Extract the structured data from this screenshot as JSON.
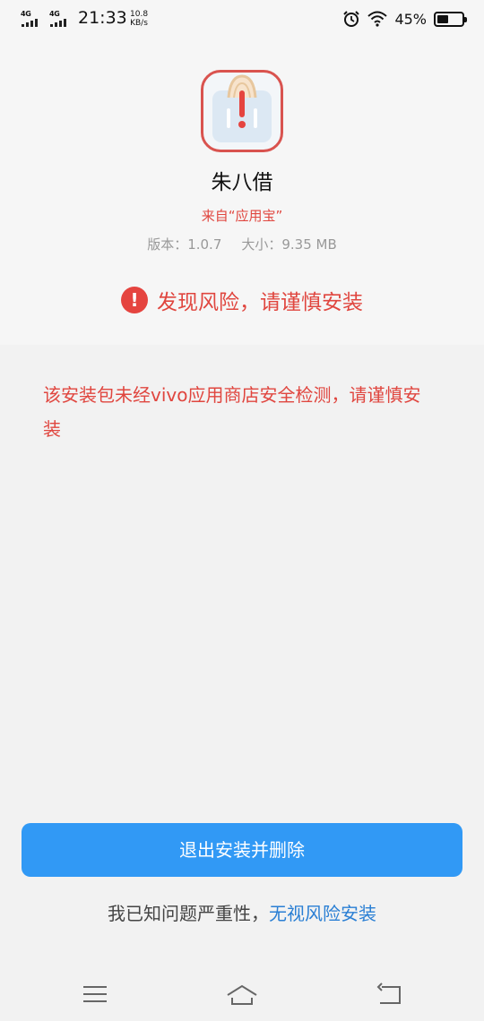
{
  "status_bar": {
    "sim1": "4G",
    "sim2": "4G",
    "time": "21:33",
    "net_speed_value": "10.8",
    "net_speed_unit": "KB/s",
    "battery_percent": "45%",
    "battery_level": 0.45,
    "icons": [
      "signal-icon",
      "signal-icon",
      "alarm-icon",
      "wifi-icon",
      "battery-icon"
    ]
  },
  "app": {
    "name": "朱八借",
    "source": "来自“应用宝”",
    "version": "版本：1.0.7",
    "size": "大小：9.35 MB",
    "icon": "app-icon"
  },
  "risk": {
    "icon": "exclamation-icon",
    "title": "发现风险，请谨慎安装"
  },
  "warning": {
    "text": "该安装包未经vivo应用商店安全检测，请谨慎安装"
  },
  "actions": {
    "primary_label": "退出安装并删除",
    "ignore_prefix": "我已知问题严重性，",
    "ignore_link": "无视风险安装"
  },
  "nav_bar": {
    "icons": [
      "menu-icon",
      "home-icon",
      "back-icon"
    ]
  },
  "colors": {
    "risk_red": "#e0463f",
    "primary_blue": "#3199f5",
    "link_blue": "#2a7fd4"
  }
}
